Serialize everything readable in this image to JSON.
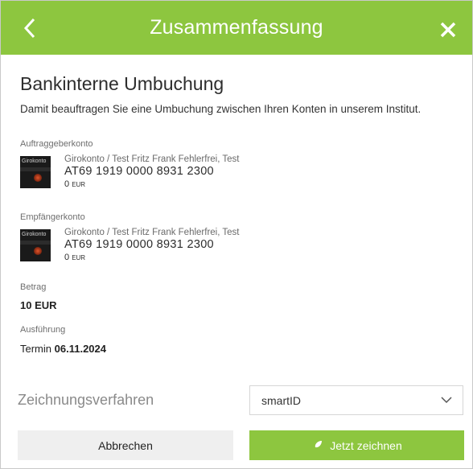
{
  "header": {
    "title": "Zusammenfassung",
    "back_icon": "chevron-left-icon",
    "close_icon": "close-icon",
    "accent": "#8dc63f"
  },
  "main": {
    "heading": "Bankinterne Umbuchung",
    "intro": "Damit beauftragen Sie eine Umbuchung zwischen Ihren Konten in unserem Institut.",
    "sender": {
      "label": "Auftraggeberkonto",
      "card_text": "Girokonto",
      "name": "Girokonto / Test Fritz Frank Fehlerfrei, Test",
      "iban": "AT69 1919 0000 8931 2300",
      "balance": "0",
      "currency": "EUR"
    },
    "recipient": {
      "label": "Empfängerkonto",
      "card_text": "Girokonto",
      "name": "Girokonto / Test Fritz Frank Fehlerfrei, Test",
      "iban": "AT69 1919 0000 8931 2300",
      "balance": "0",
      "currency": "EUR"
    },
    "amount": {
      "label": "Betrag",
      "value": "10 EUR"
    },
    "execution": {
      "label": "Ausführung",
      "prefix": "Termin",
      "date": "06.11.2024"
    }
  },
  "signing": {
    "label": "Zeichnungsverfahren",
    "selected": "smartID"
  },
  "actions": {
    "cancel_label": "Abbrechen",
    "sign_label": "Jetzt zeichnen"
  }
}
